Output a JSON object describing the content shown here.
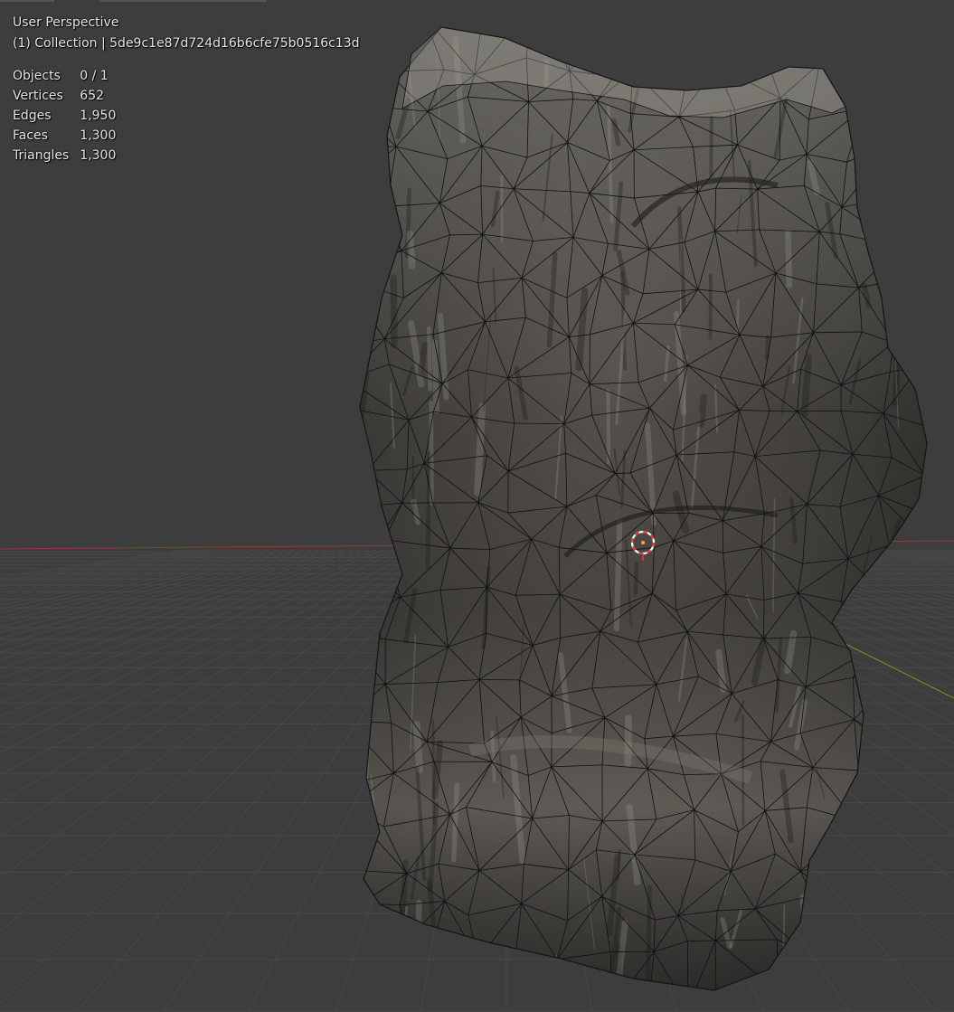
{
  "viewport": {
    "view_mode": "User Perspective",
    "collection_info": "(1) Collection | 5de9c1e87d724d16b6cfe75b0516c13d",
    "stats": [
      {
        "label": "Objects",
        "value": "0 / 1"
      },
      {
        "label": "Vertices",
        "value": "652"
      },
      {
        "label": "Edges",
        "value": "1,950"
      },
      {
        "label": "Faces",
        "value": "1,300"
      },
      {
        "label": "Triangles",
        "value": "1,300"
      }
    ]
  },
  "colors": {
    "background": "#3d3d3d",
    "grid_line": "#474747",
    "x_axis": "#8a3b3b",
    "y_axis": "#6a8e2f",
    "mesh_wire": "#111111",
    "cursor_red": "#e23b3b",
    "cursor_white": "#ffffff"
  },
  "icons": {
    "cursor": "3d-cursor-icon"
  }
}
